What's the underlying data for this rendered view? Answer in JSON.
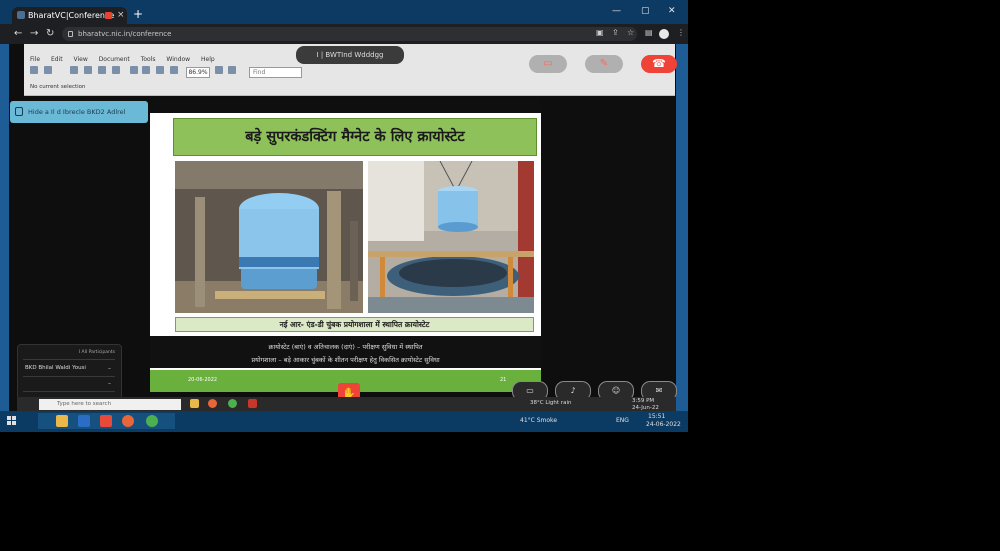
{
  "browser": {
    "tab_title": "BharatVC|Conference",
    "new_tab": "+",
    "tab_close": "×",
    "url": "bharatvc.nic.in/conference",
    "window_min": "—",
    "window_max": "▢",
    "window_close": "✕"
  },
  "remote_app": {
    "menu": [
      "File",
      "Edit",
      "View",
      "Document",
      "Tools",
      "Window",
      "Help"
    ],
    "zoom": "86.9%",
    "find_placeholder": "Find",
    "selection_status": "No current selection"
  },
  "conference": {
    "presenter_pill": "I  | BWTInd Wdddgg",
    "side_button": "Hide a Il d Ibrecle BKD2 Adlrel"
  },
  "slide": {
    "title": "बड़े सुपरकंडक्टिंग मैग्नेट के लिए क्रायोस्टेट",
    "caption": "नई आर- एंड-डी चुंबक प्रयोगशाला में स्थापित क्रायोस्टेट",
    "subtitle_line1": "क्रायोस्टेट (बाएं) व अतिचालक (दाएं) – परीक्षण सुविधा में स्थापित",
    "subtitle_line2": "प्रयोगशाला – बड़े आकार चुंबकों के शीतन परीक्षण हेतु विकसित क्रायोस्टेट सुविधा",
    "footer_date": "20-06-2022",
    "footer_page": "21"
  },
  "participants_popup": {
    "header": "I  All Participants",
    "name": "BKD Bhilal Waldi Yousi"
  },
  "remote_taskbar": {
    "search_placeholder": "Type here to search",
    "weather": "38°C  Light rain",
    "time": "3:59 PM",
    "date": "24-Jun-22"
  },
  "host_taskbar": {
    "weather": "41°C  Smoke",
    "lang": "ENG",
    "time": "15:51",
    "date": "24-06-2022"
  }
}
